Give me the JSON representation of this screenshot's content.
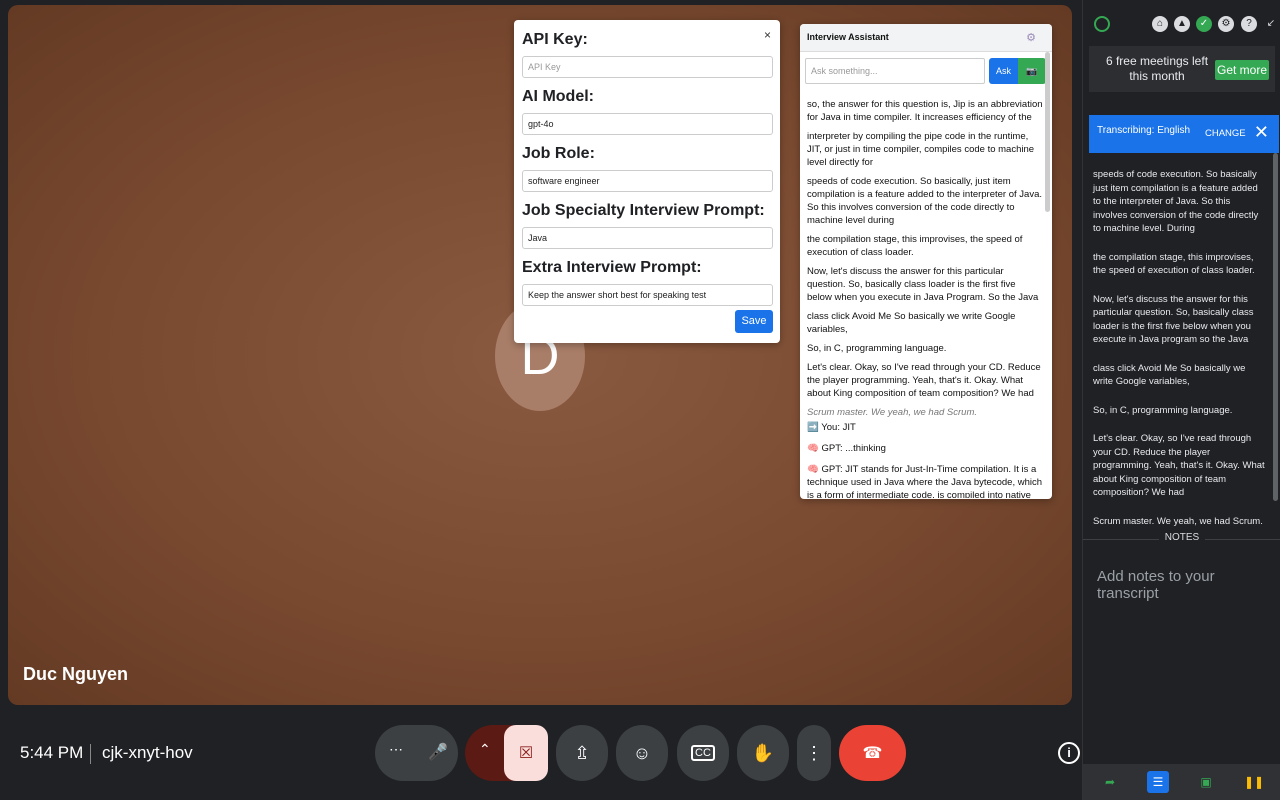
{
  "meeting": {
    "participant_name": "Duc Nguyen",
    "avatar_initial": "D",
    "time": "5:44 PM",
    "code": "cjk-xnyt-hov"
  },
  "settings_popup": {
    "close_label": "×",
    "api_key_label": "API Key:",
    "api_key_placeholder": "API Key",
    "model_label": "AI Model:",
    "model_value": "gpt-4o",
    "job_role_label": "Job Role:",
    "job_role_value": "software engineer",
    "specialty_label": "Job Specialty Interview Prompt:",
    "specialty_value": "Java",
    "extra_label": "Extra Interview Prompt:",
    "extra_value": "Keep the answer short best for speaking test",
    "save_label": "Save"
  },
  "assistant": {
    "title": "Interview Assistant",
    "ask_placeholder": "Ask something...",
    "ask_label": "Ask",
    "paragraphs": [
      "so, the answer for this question is, Jip is an abbreviation for Java in time compiler. It increases efficiency of the",
      "interpreter by compiling the pipe code in the runtime, JIT, or just in time compiler, compiles code to machine level directly for",
      "speeds of code execution. So basically, just item compilation is a feature added to the interpreter of Java. So this involves conversion of the code directly to machine level during",
      "the compilation stage, this improvises, the speed of execution of class loader.",
      "Now, let's discuss the answer for this particular question. So, basically class loader is the first five below when you execute in Java Program. So the Java",
      "class click Avoid Me So basically we write Google variables,",
      "So, in C, programming language.",
      "Let's clear. Okay, so I've read through your CD. Reduce the player programming. Yeah, that's it. Okay. What about King composition of team composition? We had"
    ],
    "muted_line": "Scrum master. We yeah, we had Scrum.",
    "you_line": "You: JIT",
    "gpt_thinking": "GPT: ...thinking",
    "gpt_answer": "GPT: JIT stands for Just-In-Time compilation. It is a technique used in Java where the Java bytecode, which is a form of intermediate code, is compiled into native machine"
  },
  "panel": {
    "meetings_text": "6 free meetings left this month",
    "get_more_label": "Get more",
    "transcribing_label": "Transcribing: English",
    "change_label": "CHANGE",
    "transcript": [
      "speeds of code execution. So basically just item compilation is a feature added to the interpreter of Java. So this involves conversion of the code directly to machine level. During",
      "the compilation stage, this improvises, the speed of execution of class loader.",
      "Now, let's discuss the answer for this particular question. So, basically class loader is the first five below when you execute in Java program so the Java",
      "class click Avoid Me So basically we write Google variables,",
      "So, in C, programming language.",
      "Let's clear. Okay, so I've read through your CD. Reduce the player programming. Yeah, that's it. Okay. What about King composition of team composition? We had",
      "Scrum master. We yeah, we had Scrum."
    ],
    "notes_label": "NOTES",
    "notes_placeholder": "Add notes to your transcript"
  },
  "icons": {
    "more": "more-options-icon",
    "mic": "microphone-icon",
    "camera_off": "camera-off-icon",
    "present": "present-screen-icon",
    "emoji": "emoji-icon",
    "captions": "captions-icon",
    "hand": "raise-hand-icon",
    "leave": "leave-call-icon"
  },
  "colors": {
    "accent": "#1a73e8",
    "leave": "#ea4335",
    "green": "#34a853"
  }
}
